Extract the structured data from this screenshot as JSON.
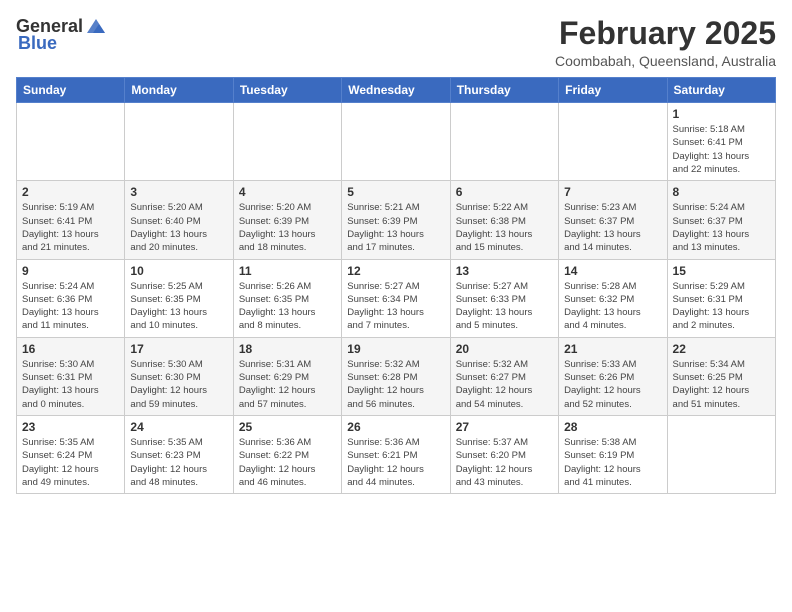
{
  "header": {
    "logo_general": "General",
    "logo_blue": "Blue",
    "title": "February 2025",
    "subtitle": "Coombabah, Queensland, Australia"
  },
  "calendar": {
    "days_of_week": [
      "Sunday",
      "Monday",
      "Tuesday",
      "Wednesday",
      "Thursday",
      "Friday",
      "Saturday"
    ],
    "weeks": [
      [
        {
          "day": "",
          "info": ""
        },
        {
          "day": "",
          "info": ""
        },
        {
          "day": "",
          "info": ""
        },
        {
          "day": "",
          "info": ""
        },
        {
          "day": "",
          "info": ""
        },
        {
          "day": "",
          "info": ""
        },
        {
          "day": "1",
          "info": "Sunrise: 5:18 AM\nSunset: 6:41 PM\nDaylight: 13 hours\nand 22 minutes."
        }
      ],
      [
        {
          "day": "2",
          "info": "Sunrise: 5:19 AM\nSunset: 6:41 PM\nDaylight: 13 hours\nand 21 minutes."
        },
        {
          "day": "3",
          "info": "Sunrise: 5:20 AM\nSunset: 6:40 PM\nDaylight: 13 hours\nand 20 minutes."
        },
        {
          "day": "4",
          "info": "Sunrise: 5:20 AM\nSunset: 6:39 PM\nDaylight: 13 hours\nand 18 minutes."
        },
        {
          "day": "5",
          "info": "Sunrise: 5:21 AM\nSunset: 6:39 PM\nDaylight: 13 hours\nand 17 minutes."
        },
        {
          "day": "6",
          "info": "Sunrise: 5:22 AM\nSunset: 6:38 PM\nDaylight: 13 hours\nand 15 minutes."
        },
        {
          "day": "7",
          "info": "Sunrise: 5:23 AM\nSunset: 6:37 PM\nDaylight: 13 hours\nand 14 minutes."
        },
        {
          "day": "8",
          "info": "Sunrise: 5:24 AM\nSunset: 6:37 PM\nDaylight: 13 hours\nand 13 minutes."
        }
      ],
      [
        {
          "day": "9",
          "info": "Sunrise: 5:24 AM\nSunset: 6:36 PM\nDaylight: 13 hours\nand 11 minutes."
        },
        {
          "day": "10",
          "info": "Sunrise: 5:25 AM\nSunset: 6:35 PM\nDaylight: 13 hours\nand 10 minutes."
        },
        {
          "day": "11",
          "info": "Sunrise: 5:26 AM\nSunset: 6:35 PM\nDaylight: 13 hours\nand 8 minutes."
        },
        {
          "day": "12",
          "info": "Sunrise: 5:27 AM\nSunset: 6:34 PM\nDaylight: 13 hours\nand 7 minutes."
        },
        {
          "day": "13",
          "info": "Sunrise: 5:27 AM\nSunset: 6:33 PM\nDaylight: 13 hours\nand 5 minutes."
        },
        {
          "day": "14",
          "info": "Sunrise: 5:28 AM\nSunset: 6:32 PM\nDaylight: 13 hours\nand 4 minutes."
        },
        {
          "day": "15",
          "info": "Sunrise: 5:29 AM\nSunset: 6:31 PM\nDaylight: 13 hours\nand 2 minutes."
        }
      ],
      [
        {
          "day": "16",
          "info": "Sunrise: 5:30 AM\nSunset: 6:31 PM\nDaylight: 13 hours\nand 0 minutes."
        },
        {
          "day": "17",
          "info": "Sunrise: 5:30 AM\nSunset: 6:30 PM\nDaylight: 12 hours\nand 59 minutes."
        },
        {
          "day": "18",
          "info": "Sunrise: 5:31 AM\nSunset: 6:29 PM\nDaylight: 12 hours\nand 57 minutes."
        },
        {
          "day": "19",
          "info": "Sunrise: 5:32 AM\nSunset: 6:28 PM\nDaylight: 12 hours\nand 56 minutes."
        },
        {
          "day": "20",
          "info": "Sunrise: 5:32 AM\nSunset: 6:27 PM\nDaylight: 12 hours\nand 54 minutes."
        },
        {
          "day": "21",
          "info": "Sunrise: 5:33 AM\nSunset: 6:26 PM\nDaylight: 12 hours\nand 52 minutes."
        },
        {
          "day": "22",
          "info": "Sunrise: 5:34 AM\nSunset: 6:25 PM\nDaylight: 12 hours\nand 51 minutes."
        }
      ],
      [
        {
          "day": "23",
          "info": "Sunrise: 5:35 AM\nSunset: 6:24 PM\nDaylight: 12 hours\nand 49 minutes."
        },
        {
          "day": "24",
          "info": "Sunrise: 5:35 AM\nSunset: 6:23 PM\nDaylight: 12 hours\nand 48 minutes."
        },
        {
          "day": "25",
          "info": "Sunrise: 5:36 AM\nSunset: 6:22 PM\nDaylight: 12 hours\nand 46 minutes."
        },
        {
          "day": "26",
          "info": "Sunrise: 5:36 AM\nSunset: 6:21 PM\nDaylight: 12 hours\nand 44 minutes."
        },
        {
          "day": "27",
          "info": "Sunrise: 5:37 AM\nSunset: 6:20 PM\nDaylight: 12 hours\nand 43 minutes."
        },
        {
          "day": "28",
          "info": "Sunrise: 5:38 AM\nSunset: 6:19 PM\nDaylight: 12 hours\nand 41 minutes."
        },
        {
          "day": "",
          "info": ""
        }
      ]
    ]
  }
}
